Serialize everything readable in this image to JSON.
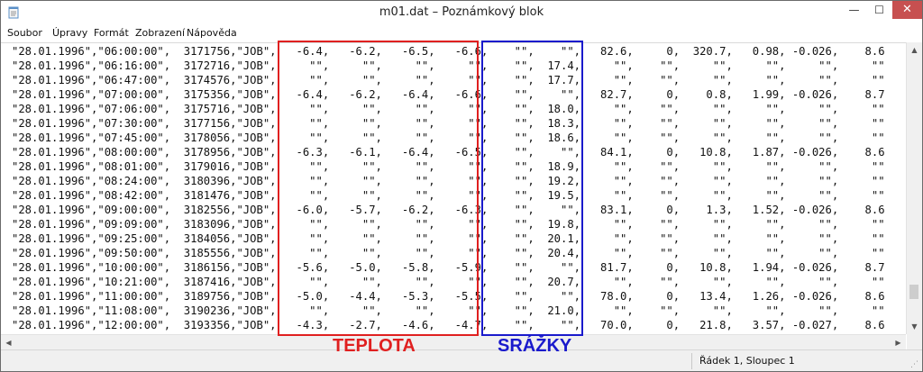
{
  "window": {
    "title": "m01.dat – Poznámkový blok",
    "controls": {
      "minimize": "—",
      "maximize": "☐",
      "close": "✕"
    }
  },
  "menu": [
    "Soubor",
    "Úpravy",
    "Formát",
    "Zobrazení",
    "Nápověda"
  ],
  "content": {
    "lines": [
      "\"28.01.1996\",\"06:00:00\",  3171756,\"JOB\",   -6.4,   -6.2,   -6.5,   -6.6,    \"\",    \"\",   82.6,     0,  320.7,   0.98, -0.026,    8.6",
      "\"28.01.1996\",\"06:16:00\",  3172716,\"JOB\",     \"\",     \"\",     \"\",     \"\",    \"\",  17.4,     \"\",    \"\",     \"\",     \"\",     \"\",     \"\"",
      "\"28.01.1996\",\"06:47:00\",  3174576,\"JOB\",     \"\",     \"\",     \"\",     \"\",    \"\",  17.7,     \"\",    \"\",     \"\",     \"\",     \"\",     \"\"",
      "\"28.01.1996\",\"07:00:00\",  3175356,\"JOB\",   -6.4,   -6.2,   -6.4,   -6.6,    \"\",    \"\",   82.7,     0,    0.8,   1.99, -0.026,    8.7",
      "\"28.01.1996\",\"07:06:00\",  3175716,\"JOB\",     \"\",     \"\",     \"\",     \"\",    \"\",  18.0,     \"\",    \"\",     \"\",     \"\",     \"\",     \"\"",
      "\"28.01.1996\",\"07:30:00\",  3177156,\"JOB\",     \"\",     \"\",     \"\",     \"\",    \"\",  18.3,     \"\",    \"\",     \"\",     \"\",     \"\",     \"\"",
      "\"28.01.1996\",\"07:45:00\",  3178056,\"JOB\",     \"\",     \"\",     \"\",     \"\",    \"\",  18.6,     \"\",    \"\",     \"\",     \"\",     \"\",     \"\"",
      "\"28.01.1996\",\"08:00:00\",  3178956,\"JOB\",   -6.3,   -6.1,   -6.4,   -6.5,    \"\",    \"\",   84.1,     0,   10.8,   1.87, -0.026,    8.6",
      "\"28.01.1996\",\"08:01:00\",  3179016,\"JOB\",     \"\",     \"\",     \"\",     \"\",    \"\",  18.9,     \"\",    \"\",     \"\",     \"\",     \"\",     \"\"",
      "\"28.01.1996\",\"08:24:00\",  3180396,\"JOB\",     \"\",     \"\",     \"\",     \"\",    \"\",  19.2,     \"\",    \"\",     \"\",     \"\",     \"\",     \"\"",
      "\"28.01.1996\",\"08:42:00\",  3181476,\"JOB\",     \"\",     \"\",     \"\",     \"\",    \"\",  19.5,     \"\",    \"\",     \"\",     \"\",     \"\",     \"\"",
      "\"28.01.1996\",\"09:00:00\",  3182556,\"JOB\",   -6.0,   -5.7,   -6.2,   -6.3,    \"\",    \"\",   83.1,     0,    1.3,   1.52, -0.026,    8.6",
      "\"28.01.1996\",\"09:09:00\",  3183096,\"JOB\",     \"\",     \"\",     \"\",     \"\",    \"\",  19.8,     \"\",    \"\",     \"\",     \"\",     \"\",     \"\"",
      "\"28.01.1996\",\"09:25:00\",  3184056,\"JOB\",     \"\",     \"\",     \"\",     \"\",    \"\",  20.1,     \"\",    \"\",     \"\",     \"\",     \"\",     \"\"",
      "\"28.01.1996\",\"09:50:00\",  3185556,\"JOB\",     \"\",     \"\",     \"\",     \"\",    \"\",  20.4,     \"\",    \"\",     \"\",     \"\",     \"\",     \"\"",
      "\"28.01.1996\",\"10:00:00\",  3186156,\"JOB\",   -5.6,   -5.0,   -5.8,   -5.9,    \"\",    \"\",   81.7,     0,   10.8,   1.94, -0.026,    8.7",
      "\"28.01.1996\",\"10:21:00\",  3187416,\"JOB\",     \"\",     \"\",     \"\",     \"\",    \"\",  20.7,     \"\",    \"\",     \"\",     \"\",     \"\",     \"\"",
      "\"28.01.1996\",\"11:00:00\",  3189756,\"JOB\",   -5.0,   -4.4,   -5.3,   -5.5,    \"\",    \"\",   78.0,     0,   13.4,   1.26, -0.026,    8.6",
      "\"28.01.1996\",\"11:08:00\",  3190236,\"JOB\",     \"\",     \"\",     \"\",     \"\",    \"\",  21.0,     \"\",    \"\",     \"\",     \"\",     \"\",     \"\"",
      "\"28.01.1996\",\"12:00:00\",  3193356,\"JOB\",   -4.3,   -2.7,   -4.6,   -4.7,    \"\",    \"\",   70.0,     0,   21.8,   3.57, -0.027,    8.6"
    ]
  },
  "annotations": {
    "temperature_label": "TEPLOTA",
    "precipitation_label": "SRÁŽKY",
    "temperature_color": "#e02020",
    "precipitation_color": "#1a1acc"
  },
  "statusbar": {
    "position": "Řádek 1, Sloupec 1"
  },
  "icons": {
    "app": "notepad-icon",
    "scroll_up": "▲",
    "scroll_down": "▼",
    "scroll_left": "◀",
    "scroll_right": "▶",
    "grip": "⋰"
  }
}
